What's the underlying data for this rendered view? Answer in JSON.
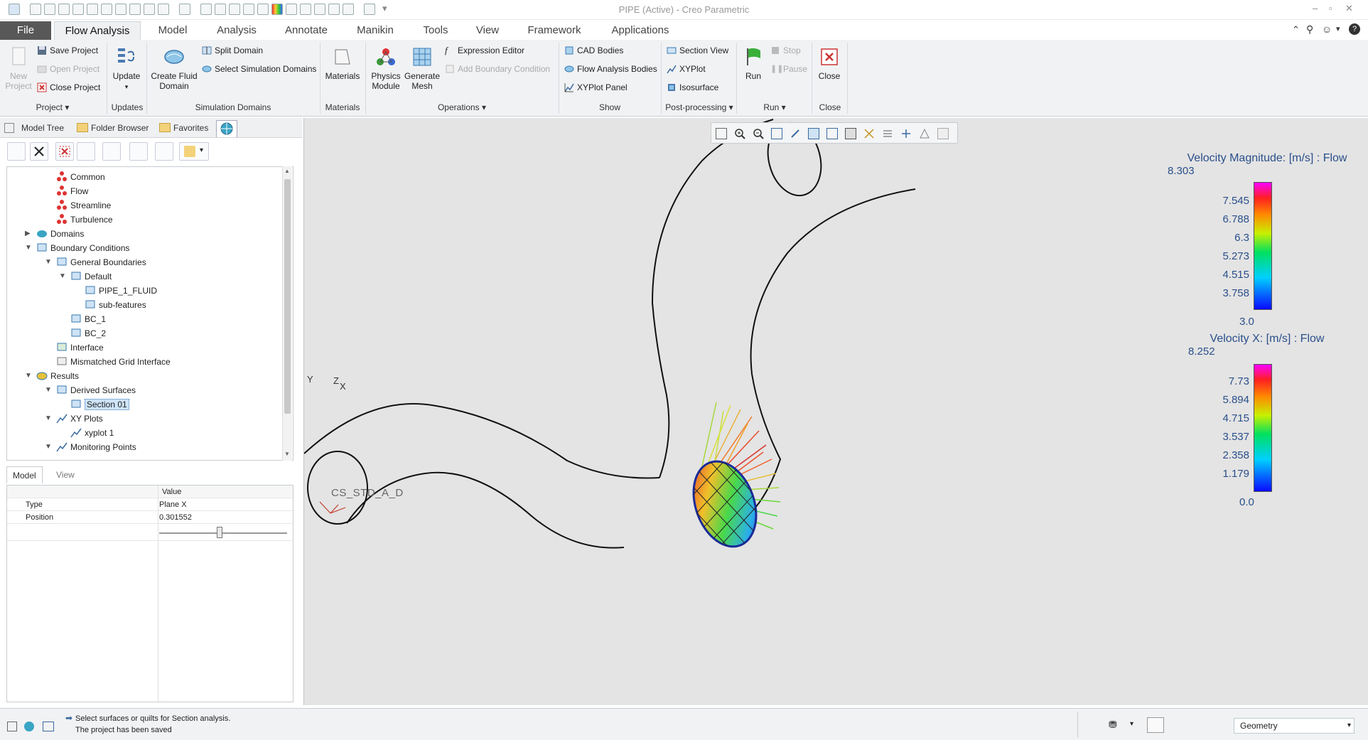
{
  "window": {
    "title": "PIPE (Active) - Creo Parametric"
  },
  "tabs": [
    {
      "label": "File"
    },
    {
      "label": "Flow Analysis"
    },
    {
      "label": "Model"
    },
    {
      "label": "Analysis"
    },
    {
      "label": "Annotate"
    },
    {
      "label": "Manikin"
    },
    {
      "label": "Tools"
    },
    {
      "label": "View"
    },
    {
      "label": "Framework"
    },
    {
      "label": "Applications"
    }
  ],
  "ribbon": {
    "project": {
      "new_project": "New\nProject",
      "save_project": "Save Project",
      "open_project": "Open Project",
      "close_project": "Close Project",
      "group_label": "Project ▾"
    },
    "updates": {
      "update": "Update",
      "group_label": "Updates"
    },
    "simulation_domains": {
      "create_fluid_domain": "Create Fluid\nDomain",
      "split_domain": "Split Domain",
      "select_simulation_domains": "Select Simulation Domains",
      "group_label": "Simulation Domains"
    },
    "materials": {
      "materials": "Materials",
      "group_label": "Materials"
    },
    "operations": {
      "physics_module": "Physics\nModule",
      "generate_mesh": "Generate\nMesh",
      "expression_editor": "Expression Editor",
      "add_boundary_condition": "Add Boundary Condition",
      "group_label": "Operations ▾"
    },
    "show": {
      "cad_bodies": "CAD Bodies",
      "flow_analysis_bodies": "Flow Analysis Bodies",
      "xyplot_panel": "XYPlot Panel",
      "group_label": "Show"
    },
    "post_processing": {
      "section_view": "Section View",
      "xyplot": "XYPlot",
      "isosurface": "Isosurface",
      "group_label": "Post-processing ▾"
    },
    "run": {
      "run": "Run",
      "stop": "Stop",
      "pause": "Pause",
      "group_label": "Run ▾"
    },
    "close": {
      "close": "Close",
      "group_label": "Close"
    }
  },
  "nav_tabs": [
    {
      "label": "Model Tree"
    },
    {
      "label": "Folder Browser"
    },
    {
      "label": "Favorites"
    }
  ],
  "tree": [
    {
      "label": "Common"
    },
    {
      "label": "Flow"
    },
    {
      "label": "Streamline"
    },
    {
      "label": "Turbulence"
    },
    {
      "label": "Domains"
    },
    {
      "label": "Boundary Conditions"
    },
    {
      "label": "General Boundaries"
    },
    {
      "label": "Default"
    },
    {
      "label": "PIPE_1_FLUID"
    },
    {
      "label": "sub-features"
    },
    {
      "label": "BC_1"
    },
    {
      "label": "BC_2"
    },
    {
      "label": "Interface"
    },
    {
      "label": "Mismatched Grid Interface"
    },
    {
      "label": "Results"
    },
    {
      "label": "Derived Surfaces"
    },
    {
      "label": "Section 01"
    },
    {
      "label": "XY Plots"
    },
    {
      "label": "xyplot 1"
    },
    {
      "label": "Monitoring Points"
    }
  ],
  "prop_tabs": [
    {
      "label": "Model"
    },
    {
      "label": "View"
    }
  ],
  "props": {
    "header_value": "Value",
    "rows": [
      {
        "name": "Type",
        "value": "Plane X"
      },
      {
        "name": "Position",
        "value": "0.301552"
      }
    ],
    "slider_fraction": 0.47
  },
  "viewport": {
    "csys_label": "CS_STD_A_D",
    "axis_labels": {
      "y": "Y",
      "z": "Z",
      "x": "X"
    },
    "legend1": {
      "title": "Velocity Magnitude: [m/s] : Flow",
      "max": "8.303",
      "ticks": [
        "7.545",
        "6.788",
        "6.3",
        "5.273",
        "4.515",
        "3.758"
      ],
      "min": "3.0"
    },
    "legend2": {
      "title": "Velocity X: [m/s] : Flow",
      "max": "8.252",
      "ticks": [
        "7.73",
        "5.894",
        "4.715",
        "3.537",
        "2.358",
        "1.179"
      ],
      "min": "0.0"
    }
  },
  "status": {
    "message1": "Select surfaces or quilts for Section analysis.",
    "message2": "The project has been saved",
    "filter": "Geometry"
  }
}
